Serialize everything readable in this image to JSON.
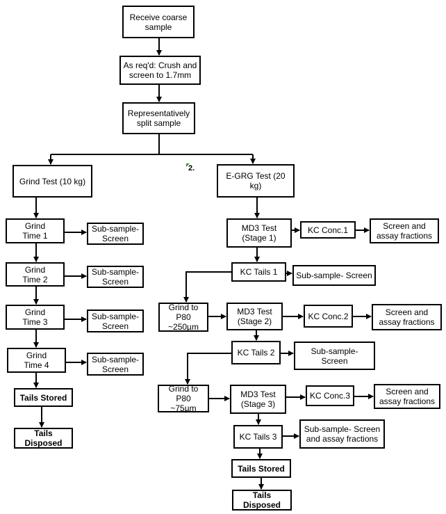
{
  "top": {
    "receive": "Receive coarse\nsample",
    "crush": "As req'd: Crush and\nscreen to 1.7mm",
    "split": "Representatively\nsplit sample",
    "marker": "2."
  },
  "left": {
    "grind_test": "Grind Test  (10 kg)",
    "grind_times": [
      "Grind\nTime 1",
      "Grind\nTime 2",
      "Grind\nTime 3",
      "Grind\nTime 4"
    ],
    "sub_samples": [
      "Sub-sample-\nScreen",
      "Sub-sample-\nScreen",
      "Sub-sample-\nScreen",
      "Sub-sample-\nScreen"
    ],
    "tails_stored": "Tails Stored",
    "tails_disposed": "Tails Disposed"
  },
  "right": {
    "egrg_test": "E-GRG Test  (20 kg)",
    "md3": [
      "MD3 Test\n(Stage 1)",
      "MD3 Test\n(Stage 2)",
      "MD3 Test\n(Stage 3)"
    ],
    "kc_conc": [
      "KC Conc.1",
      "KC Conc.2",
      "KC Conc.3"
    ],
    "screen_assay": [
      "Screen and\nassay fractions",
      "Screen and\nassay fractions",
      "Screen and\nassay fractions"
    ],
    "kc_tails": [
      "KC Tails  1",
      "KC Tails  2",
      "KC Tails  3"
    ],
    "tails_sub": [
      "Sub-sample- Screen",
      "Sub-sample- Screen",
      "Sub-sample- Screen\nand assay fractions"
    ],
    "grind_p80": [
      "Grind to P80\n~250µm",
      "Grind to P80\n~75µm"
    ],
    "tails_stored": "Tails Stored",
    "tails_disposed": "Tails Disposed"
  }
}
